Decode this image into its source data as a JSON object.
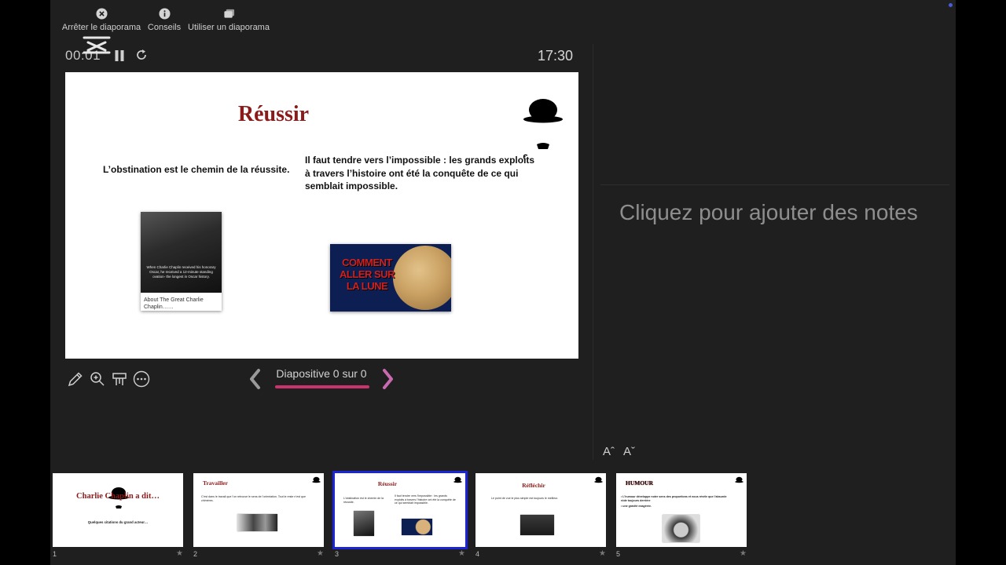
{
  "toolbar": {
    "stop_label": "Arrêter le diaporama",
    "tips_label": "Conseils",
    "use_label": "Utiliser un diaporama"
  },
  "presenter": {
    "elapsed": "00:01",
    "clock": "17:30",
    "slide_counter": "Diapositive 0 sur 0",
    "notes_placeholder": "Cliquez pour ajouter des notes",
    "font_increase": "Aˆ",
    "font_decrease": "Aˇ"
  },
  "slide": {
    "title": "Réussir",
    "quote_left": "L’obstination est le chemin de la réussite.",
    "quote_right": "Il faut tendre vers l’impossible : les grands exploits à travers l’histoire ont été la conquête de ce qui semblait impossible.",
    "photo_caption": "When Charlie Chaplin received his honorary Oscar, he received a 12-minute standing ovation- the longest in Oscar history.",
    "photo_title": "About The Great Charlie Chaplin……",
    "moon_text": "COMMENT ALLER SUR LA LUNE"
  },
  "thumbnails": [
    {
      "num": "1",
      "title": "Charlie Chaplin a dit…",
      "text": "Quelques citations du grand acteur…"
    },
    {
      "num": "2",
      "title": "Travailler",
      "text": "C’est dans le travail que l’on retrouve le sens de l’orientation. Tout le reste n’est que chimères."
    },
    {
      "num": "3",
      "title": "Réussir",
      "text": "L’obstination est le chemin de la réussite.",
      "text2": "Il faut tendre vers l’impossible : les grands exploits à travers l’histoire ont été la conquête de ce qui semblait impossible."
    },
    {
      "num": "4",
      "title": "Réfléchir",
      "text": "Le point de vue le plus simple est toujours le meilleur."
    },
    {
      "num": "5",
      "title": "HUMOUR",
      "text": "• L’humour développe notre sens des proportions et nous révèle que l’absurde rôde toujours derrière",
      "text2": "• une gravité exagérée."
    }
  ],
  "colors": {
    "accent": "#c9336e",
    "selection": "#1c24d8",
    "slide_title": "#8b1a1a",
    "background": "#1f1f1f"
  },
  "progress": {
    "fraction": 1.0
  }
}
